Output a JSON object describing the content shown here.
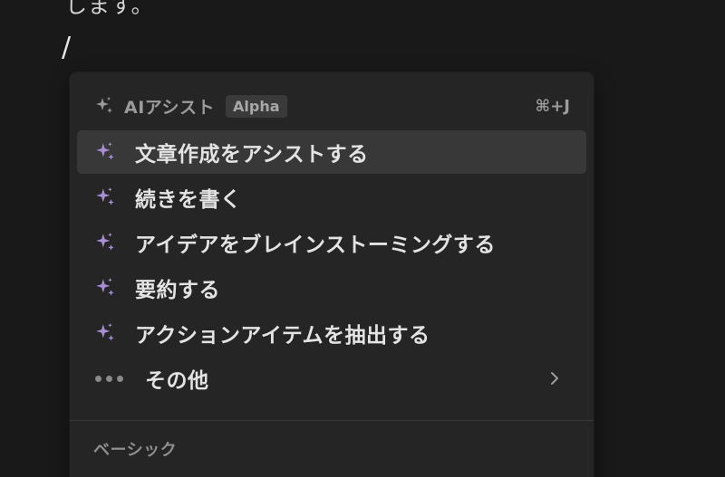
{
  "document": {
    "text_fragment": "します。",
    "cursor_text": "/"
  },
  "menu": {
    "ai_section": {
      "title": "AIアシスト",
      "badge": "Alpha",
      "shortcut": "⌘+J"
    },
    "items": [
      {
        "label": "文章作成をアシストする",
        "icon": "sparkle-icon",
        "selected": true
      },
      {
        "label": "続きを書く",
        "icon": "sparkle-icon",
        "selected": false
      },
      {
        "label": "アイデアをブレインストーミングする",
        "icon": "sparkle-icon",
        "selected": false
      },
      {
        "label": "要約する",
        "icon": "sparkle-icon",
        "selected": false
      },
      {
        "label": "アクションアイテムを抽出する",
        "icon": "sparkle-icon",
        "selected": false
      }
    ],
    "more": {
      "label": "その他",
      "icon": "more-dots-icon",
      "trailing_icon": "chevron-right-icon"
    },
    "basic_section": {
      "title": "ベーシック"
    }
  },
  "colors": {
    "background": "#191919",
    "menu_background": "#252525",
    "selected_background": "#383838",
    "sparkle_purple": "#a98fd6",
    "text_primary": "#e3e3e3",
    "text_secondary": "#9b9b9b"
  }
}
